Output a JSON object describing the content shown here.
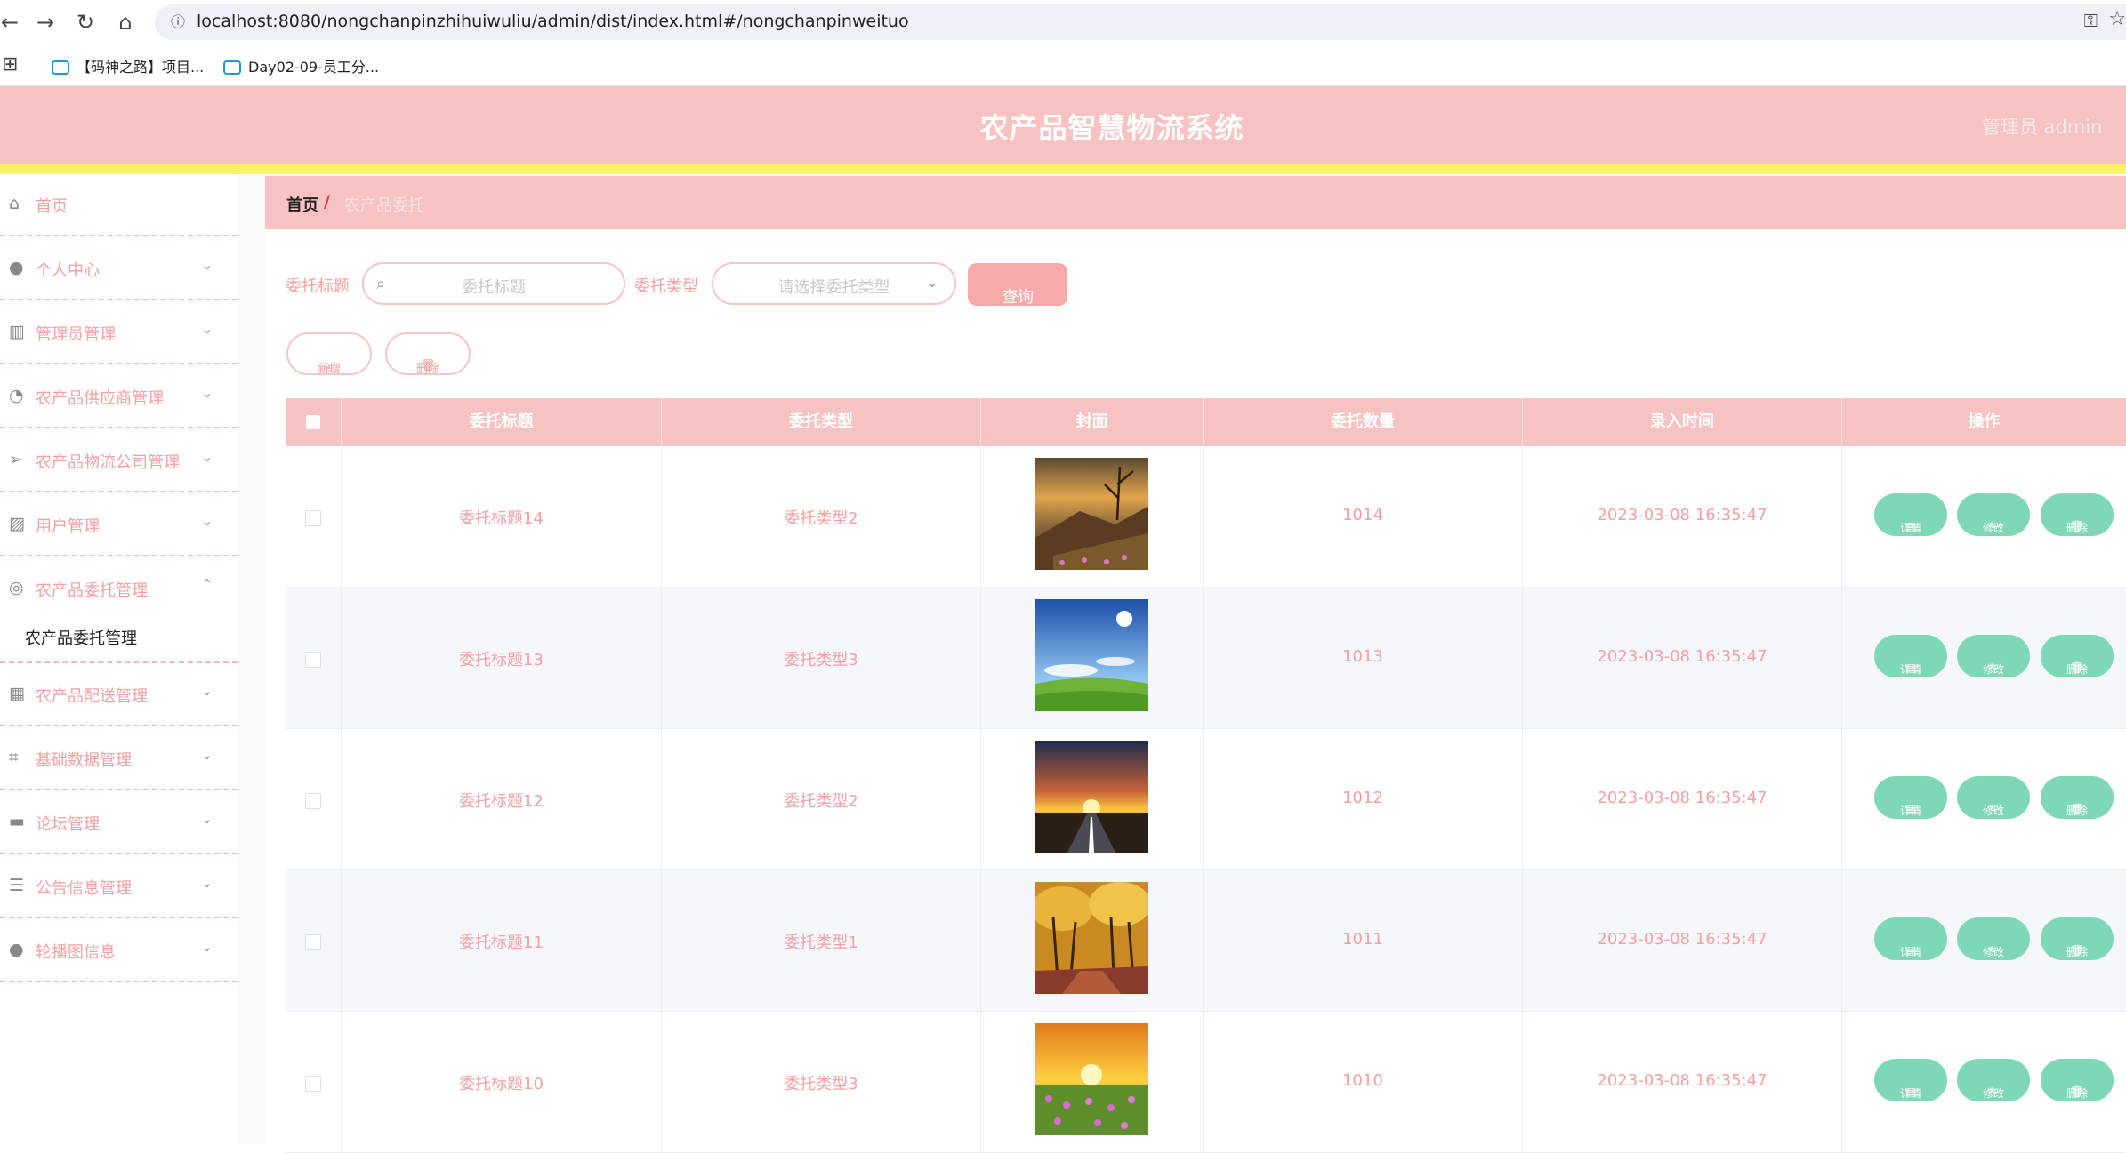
{
  "browser": {
    "url": "localhost:8080/nongchanpinzhihuiwuliu/admin/dist/index.html#/nongchanpinweituo",
    "bookmarks": [
      "【码神之路】项目...",
      "Day02-09-员工分..."
    ]
  },
  "header": {
    "title": "农产品智慧物流系统",
    "user": "管理员 admin"
  },
  "sidebar": {
    "items": [
      {
        "label": "首页",
        "icon": "home-icon"
      },
      {
        "label": "个人中心",
        "icon": "user-icon"
      },
      {
        "label": "管理员管理",
        "icon": "books-icon"
      },
      {
        "label": "农产品供应商管理",
        "icon": "dashboard-icon"
      },
      {
        "label": "农产品物流公司管理",
        "icon": "send-icon"
      },
      {
        "label": "用户管理",
        "icon": "chart-icon"
      },
      {
        "label": "农产品委托管理",
        "icon": "lifebuoy-icon"
      },
      {
        "label": "农产品配送管理",
        "icon": "grid-icon"
      },
      {
        "label": "基础数据管理",
        "icon": "crop-icon"
      },
      {
        "label": "论坛管理",
        "icon": "briefcase-icon"
      },
      {
        "label": "公告信息管理",
        "icon": "sliders-icon"
      },
      {
        "label": "轮播图信息",
        "icon": "pin-icon"
      }
    ],
    "submenu_label": "农产品委托管理"
  },
  "breadcrumb": {
    "home": "首页",
    "separator": "/",
    "current": "农产品委托"
  },
  "search": {
    "title_label": "委托标题",
    "title_placeholder": "委托标题",
    "type_label": "委托类型",
    "type_placeholder": "请选择委托类型",
    "query_button": "查询"
  },
  "actions": {
    "add": "新增",
    "delete": "删除"
  },
  "table": {
    "columns": [
      "委托标题",
      "委托类型",
      "封面",
      "委托数量",
      "录入时间",
      "操作"
    ],
    "row_buttons": {
      "detail": "详情",
      "edit": "修改",
      "delete": "删除"
    },
    "rows": [
      {
        "title": "委托标题14",
        "type": "委托类型2",
        "quantity": "1014",
        "time": "2023-03-08 16:35:47",
        "cover": "mountain-sunset"
      },
      {
        "title": "委托标题13",
        "type": "委托类型3",
        "quantity": "1013",
        "time": "2023-03-08 16:35:47",
        "cover": "blue-sky-meadow"
      },
      {
        "title": "委托标题12",
        "type": "委托类型2",
        "quantity": "1012",
        "time": "2023-03-08 16:35:47",
        "cover": "road-sunset"
      },
      {
        "title": "委托标题11",
        "type": "委托类型1",
        "quantity": "1011",
        "time": "2023-03-08 16:35:47",
        "cover": "autumn-trees"
      },
      {
        "title": "委托标题10",
        "type": "委托类型3",
        "quantity": "1010",
        "time": "2023-03-08 16:35:47",
        "cover": "sunset-flowers"
      }
    ]
  },
  "colors": {
    "header": "#f7c2c2",
    "accent_strip": "#f9f06e",
    "text_pink": "#f4a0a0",
    "action_green": "#7ed8b6"
  }
}
